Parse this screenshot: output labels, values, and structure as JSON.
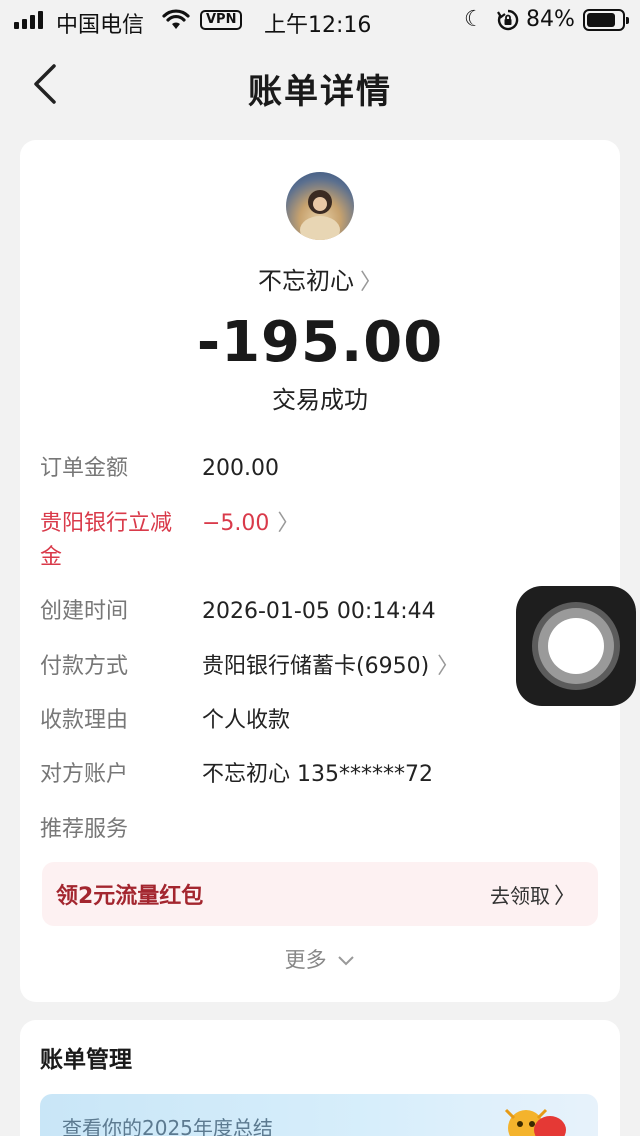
{
  "status_bar": {
    "carrier": "中国电信",
    "vpn": "VPN",
    "time": "上午12:16",
    "battery": "84%",
    "battery_level": 0.84,
    "icons": [
      "signal-icon",
      "wifi-icon",
      "moon-icon",
      "rotation-lock-icon",
      "battery-icon"
    ]
  },
  "nav": {
    "title": "账单详情",
    "back_icon": "chevron-left-icon"
  },
  "transaction": {
    "payee": "不忘初心",
    "amount": "-195.00",
    "status": "交易成功",
    "details": [
      {
        "label": "订单金额",
        "value": "200.00"
      },
      {
        "label": "贵阳银行立减金",
        "value": "−5.00",
        "highlight_color": "#d93a4a"
      },
      {
        "label": "创建时间",
        "value": "2026-01-05 00:14:44"
      },
      {
        "label": "付款方式",
        "value": "贵阳银行储蓄卡(6950)"
      },
      {
        "label": "收款理由",
        "value": "个人收款"
      },
      {
        "label": "对方账户",
        "value": "不忘初心 135******72"
      },
      {
        "label": "推荐服务",
        "value": ""
      }
    ]
  },
  "promo": {
    "title": "领2元流量红包",
    "action": "去领取"
  },
  "more": {
    "label": "更多"
  },
  "bill_management": {
    "heading": "账单管理",
    "banner_text": "查看你的2025年度总结"
  }
}
